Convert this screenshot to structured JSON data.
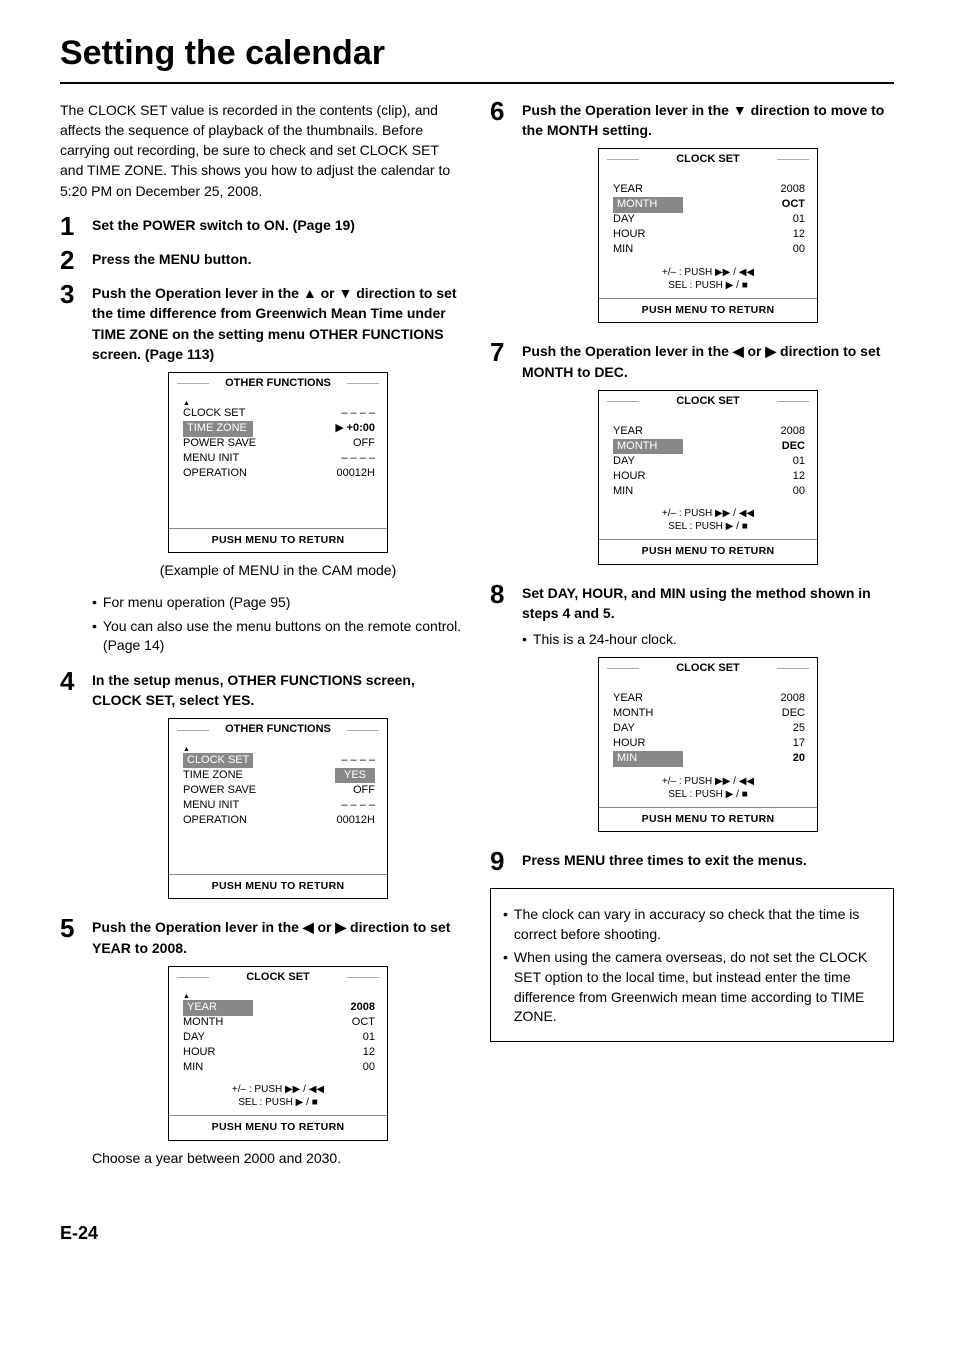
{
  "title": "Setting the calendar",
  "intro": "The CLOCK SET value is recorded in the contents (clip), and affects the sequence of playback of the thumbnails. Before carrying out recording, be sure to check and set CLOCK SET and TIME ZONE. This shows you how to adjust the calendar to 5:20 PM on December 25, 2008.",
  "steps": {
    "s1": {
      "num": "1",
      "title": "Set the POWER switch to ON. (Page 19)"
    },
    "s2": {
      "num": "2",
      "title": "Press the MENU button."
    },
    "s3": {
      "num": "3",
      "title_pre": "Push the Operation lever in the ",
      "title_mid": " or ",
      "title_post": " direction to set the time difference from Greenwich Mean Time under TIME ZONE on the setting menu OTHER FUNCTIONS screen. (Page 113)",
      "caption": "(Example of MENU in the CAM mode)",
      "bullets": [
        "For menu operation (Page 95)",
        "You can also use the menu buttons on the remote control. (Page 14)"
      ]
    },
    "s4": {
      "num": "4",
      "title": "In the setup menus, OTHER FUNCTIONS screen, CLOCK SET, select YES."
    },
    "s5": {
      "num": "5",
      "title_pre": "Push the Operation lever in the ",
      "title_mid": " or ",
      "title_post": " direction to set YEAR to 2008.",
      "caption": "Choose a year between 2000 and 2030."
    },
    "s6": {
      "num": "6",
      "title_pre": "Push the Operation lever in the ",
      "title_post": " direction to move to the MONTH setting."
    },
    "s7": {
      "num": "7",
      "title_pre": "Push the Operation lever in the ",
      "title_mid": " or ",
      "title_post": " direction to set MONTH to DEC."
    },
    "s8": {
      "num": "8",
      "title": "Set DAY, HOUR, and MIN using the method shown in steps 4 and 5.",
      "bullets": [
        "This is a 24-hour clock."
      ]
    },
    "s9": {
      "num": "9",
      "title": "Press MENU three times to exit the menus."
    }
  },
  "note_bullets": [
    "The clock can vary in accuracy so check that the time is correct before shooting.",
    "When using the camera overseas, do not set the CLOCK SET option to the local time, but instead enter the time difference from Greenwich mean time according to TIME ZONE."
  ],
  "screens": {
    "other1": {
      "title": "OTHER FUNCTIONS",
      "rows": [
        {
          "label": "CLOCK SET",
          "val": "– – – –"
        },
        {
          "label": "TIME ZONE",
          "val": "+0:00",
          "hl": true,
          "cursor": "▶"
        },
        {
          "label": "POWER SAVE",
          "val": "OFF"
        },
        {
          "label": "MENU INIT",
          "val": "– – – –"
        },
        {
          "label": "OPERATION",
          "val": "00012H"
        }
      ],
      "footer": "PUSH  MENU TO RETURN"
    },
    "other2": {
      "title": "OTHER FUNCTIONS",
      "rows": [
        {
          "label": "CLOCK SET",
          "val": "– – – –",
          "hl": true
        },
        {
          "label": "TIME ZONE",
          "val": "YES",
          "valhl": true
        },
        {
          "label": "POWER SAVE",
          "val": "OFF"
        },
        {
          "label": "MENU INIT",
          "val": "– – – –"
        },
        {
          "label": "OPERATION",
          "val": "00012H"
        }
      ],
      "footer": "PUSH  MENU TO RETURN"
    },
    "clock1": {
      "title": "CLOCK SET",
      "rows": [
        {
          "label": "YEAR",
          "val": "2008",
          "hl": true,
          "valbold": true
        },
        {
          "label": "MONTH",
          "val": "OCT"
        },
        {
          "label": "DAY",
          "val": "01"
        },
        {
          "label": "HOUR",
          "val": "12"
        },
        {
          "label": "MIN",
          "val": "00"
        }
      ],
      "hints": [
        "+/– : PUSH ▶▶ / ◀◀",
        "SEL : PUSH ▶ / ■"
      ],
      "footer": "PUSH  MENU TO RETURN"
    },
    "clock2": {
      "title": "CLOCK SET",
      "rows": [
        {
          "label": "YEAR",
          "val": "2008"
        },
        {
          "label": "MONTH",
          "val": "OCT",
          "hl": true,
          "valbold": true
        },
        {
          "label": "DAY",
          "val": "01"
        },
        {
          "label": "HOUR",
          "val": "12"
        },
        {
          "label": "MIN",
          "val": "00"
        }
      ],
      "hints": [
        "+/– : PUSH ▶▶ / ◀◀",
        "SEL : PUSH ▶ / ■"
      ],
      "footer": "PUSH  MENU TO RETURN"
    },
    "clock3": {
      "title": "CLOCK SET",
      "rows": [
        {
          "label": "YEAR",
          "val": "2008"
        },
        {
          "label": "MONTH",
          "val": "DEC",
          "hl": true,
          "valbold": true
        },
        {
          "label": "DAY",
          "val": "01"
        },
        {
          "label": "HOUR",
          "val": "12"
        },
        {
          "label": "MIN",
          "val": "00"
        }
      ],
      "hints": [
        "+/– : PUSH ▶▶ / ◀◀",
        "SEL : PUSH ▶ / ■"
      ],
      "footer": "PUSH  MENU TO RETURN"
    },
    "clock4": {
      "title": "CLOCK SET",
      "rows": [
        {
          "label": "YEAR",
          "val": "2008"
        },
        {
          "label": "MONTH",
          "val": "DEC"
        },
        {
          "label": "DAY",
          "val": "25"
        },
        {
          "label": "HOUR",
          "val": "17"
        },
        {
          "label": "MIN",
          "val": "20",
          "hl": true,
          "valbold": true
        }
      ],
      "hints": [
        "+/– : PUSH ▶▶ / ◀◀",
        "SEL : PUSH ▶ / ■"
      ],
      "footer": "PUSH  MENU TO RETURN"
    }
  },
  "glyphs": {
    "up": "▲",
    "down": "▼",
    "left": "◀",
    "right": "▶"
  },
  "page_num": "E-24"
}
